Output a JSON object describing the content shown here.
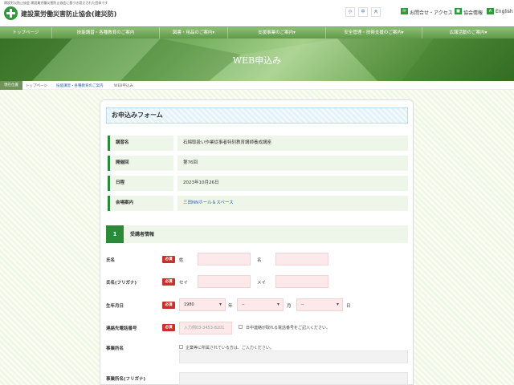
{
  "header": {
    "tagline": "建設労災防止協会 建設業労働災害防止協会に基づき設立された団体です",
    "org_name": "建設業労働災害防止協会(建災防)",
    "font_small": "小",
    "font_medium": "中",
    "font_large": "大",
    "contact": "お問合せ・アクセス",
    "info": "協会情報",
    "english": "English"
  },
  "nav": [
    "トップページ",
    "技能講習・各種教育のご案内",
    "図書・用品のご案内▾",
    "支援事業のご案内▾",
    "安全管理・技術支援のご案内▾",
    "広報活動のご案内▾"
  ],
  "banner": {
    "title": "WEB申込み"
  },
  "breadcrumb": {
    "label": "現在位置",
    "items": [
      "トップページ",
      "技能講習・各種教育のご案内",
      "WEB申込み"
    ]
  },
  "form": {
    "title": "お申込みフォーム",
    "info_rows": [
      {
        "label": "講習名",
        "value": "石綿取扱い作業従事者特別教育講師養成講座"
      },
      {
        "label": "開催回",
        "value": "第76回"
      },
      {
        "label": "日程",
        "value": "2023年10月26日"
      },
      {
        "label": "会場案内",
        "value": "三田NNホール＆スペース"
      }
    ],
    "section": {
      "number": "1",
      "title": "受講者情報"
    },
    "required": "必須",
    "name": {
      "label": "氏名",
      "sei": "姓",
      "mei": "名"
    },
    "kana": {
      "label": "氏名(フリガナ)",
      "sei": "セイ",
      "mei": "メイ"
    },
    "birth": {
      "label": "生年月日",
      "year": "1980",
      "year_unit": "年",
      "month": "--",
      "month_unit": "月",
      "day": "--",
      "day_unit": "日"
    },
    "phone": {
      "label": "連絡先電話番号",
      "placeholder": "入力例03-3453-8201",
      "note": "日中連絡が取れる電話番号をご記入ください。"
    },
    "office": {
      "label": "事業所名",
      "note": "企業等に所属されている方は、ご入力ください。"
    },
    "office_kana": {
      "label": "事業所名(フリガナ)"
    }
  },
  "colors": {
    "accent": "#2b8a3a",
    "required": "#c9302c",
    "input_bg": "#fde9ea",
    "link": "#2b5fa8"
  }
}
